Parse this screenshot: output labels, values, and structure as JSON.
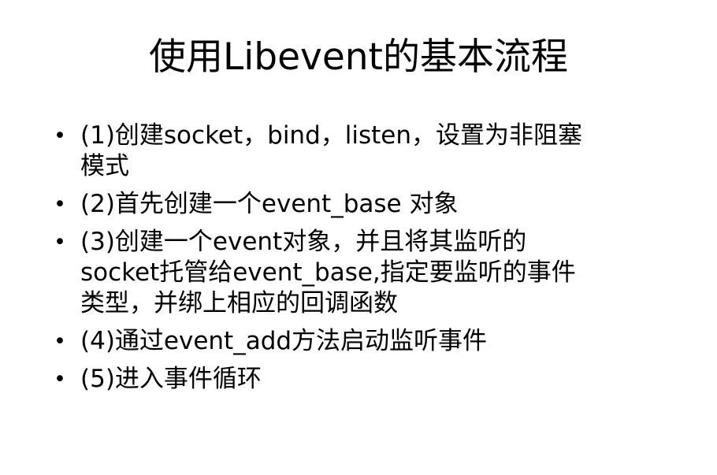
{
  "slide": {
    "title": "使用Libevent的基本流程",
    "bullets": [
      {
        "text": "(1)创建socket，bind，listen，设置为非阻塞\n模式"
      },
      {
        "text": "(2)首先创建一个event_base 对象"
      },
      {
        "text": "(3)创建一个event对象，并且将其监听的\nsocket托管给event_base,指定要监听的事件\n类型，并绑上相应的回调函数"
      },
      {
        "text": "(4)通过event_add方法启动监听事件"
      },
      {
        "text": "(5)进入事件循环"
      }
    ],
    "bullet_symbol": "•"
  }
}
